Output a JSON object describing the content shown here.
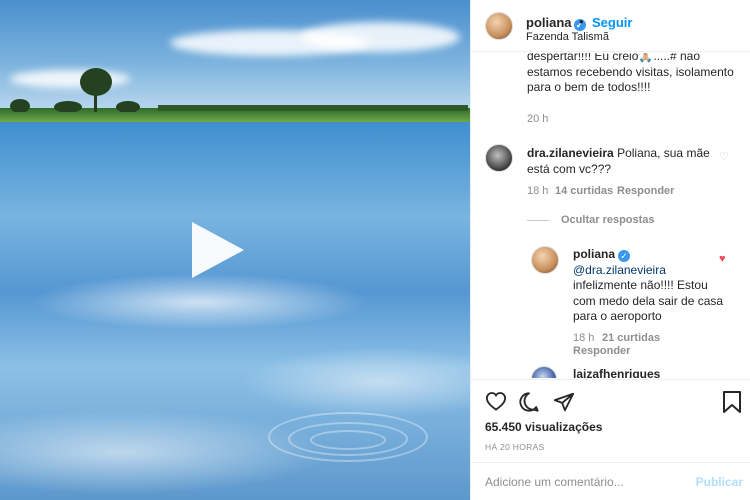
{
  "post": {
    "username": "poliana",
    "verified_glyph": "✓",
    "separator": "•",
    "follow_label": "Seguir",
    "location": "Fazenda Talismã"
  },
  "caption": {
    "text": "despertar!!!! Eu creio🙏🏼.....# não estamos recebendo visitas, isolamento para o bem de todos!!!!",
    "time": "20 h"
  },
  "comments": [
    {
      "username": "dra.zilanevieira",
      "text": "Poliana, sua mãe está com vc???",
      "time": "18 h",
      "likes": "14 curtidas",
      "reply_label": "Responder"
    }
  ],
  "hide_replies_label": "Ocultar respostas",
  "reply": {
    "username": "poliana",
    "mention": "@dra.zilanevieira",
    "text": "infelizmente não!!!! Estou com medo dela sair de casa para o aeroporto",
    "time": "18 h",
    "likes": "21 curtidas",
    "reply_label": "Responder"
  },
  "partial_comment_username": "laizafhenriques",
  "stats": {
    "views": "65.450 visualizações",
    "ago": "HÁ 20 HORAS"
  },
  "add_comment": {
    "placeholder": "Adicione um comentário...",
    "post_label": "Publicar"
  },
  "icons": [
    "play-icon",
    "heart-icon",
    "comment-icon",
    "share-icon",
    "bookmark-icon",
    "verified-icon"
  ],
  "colors": {
    "accent": "#0095f6",
    "like_red": "#ed4956",
    "muted": "#8e8e8e"
  }
}
